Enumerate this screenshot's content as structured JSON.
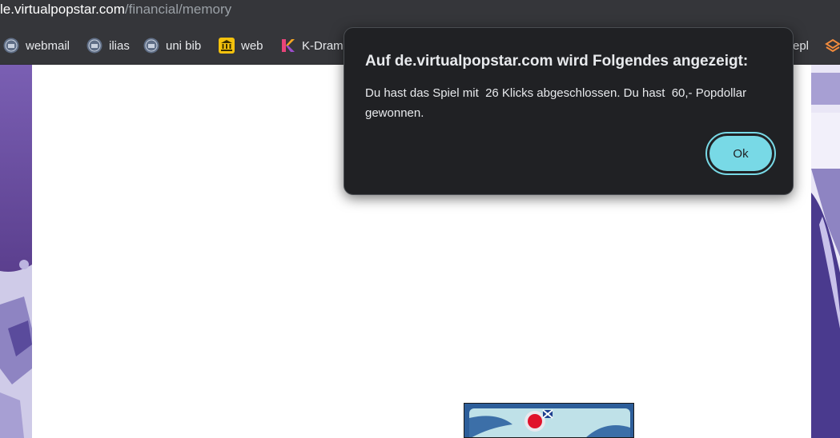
{
  "address_bar": {
    "domain": "le.virtualpopstar.com",
    "path": "/financial/memory"
  },
  "bookmarks": [
    {
      "label": "webmail",
      "icon": "university-seal-icon"
    },
    {
      "label": "ilias",
      "icon": "university-seal-icon"
    },
    {
      "label": "uni bib",
      "icon": "university-seal-icon"
    },
    {
      "label": "web",
      "icon": "bank-building-icon"
    },
    {
      "label": "K-Dram",
      "icon": "k-logo-icon"
    },
    {
      "label": "epl",
      "icon": ""
    },
    {
      "label": "",
      "icon": "layers-icon"
    }
  ],
  "dialog": {
    "title": "Auf de.virtualpopstar.com wird Folgendes angezeigt:",
    "message": "Du hast das Spiel mit  26 Klicks abgeschlossen. Du hast  60,- Popdollar gewonnen.",
    "ok_label": "Ok"
  },
  "colors": {
    "dialog_bg": "#202124",
    "ok_button": "#78d9e6",
    "toolbar_bg": "#35363a",
    "page_bg": "#ffffff",
    "side_purple": "#6a57a8"
  }
}
